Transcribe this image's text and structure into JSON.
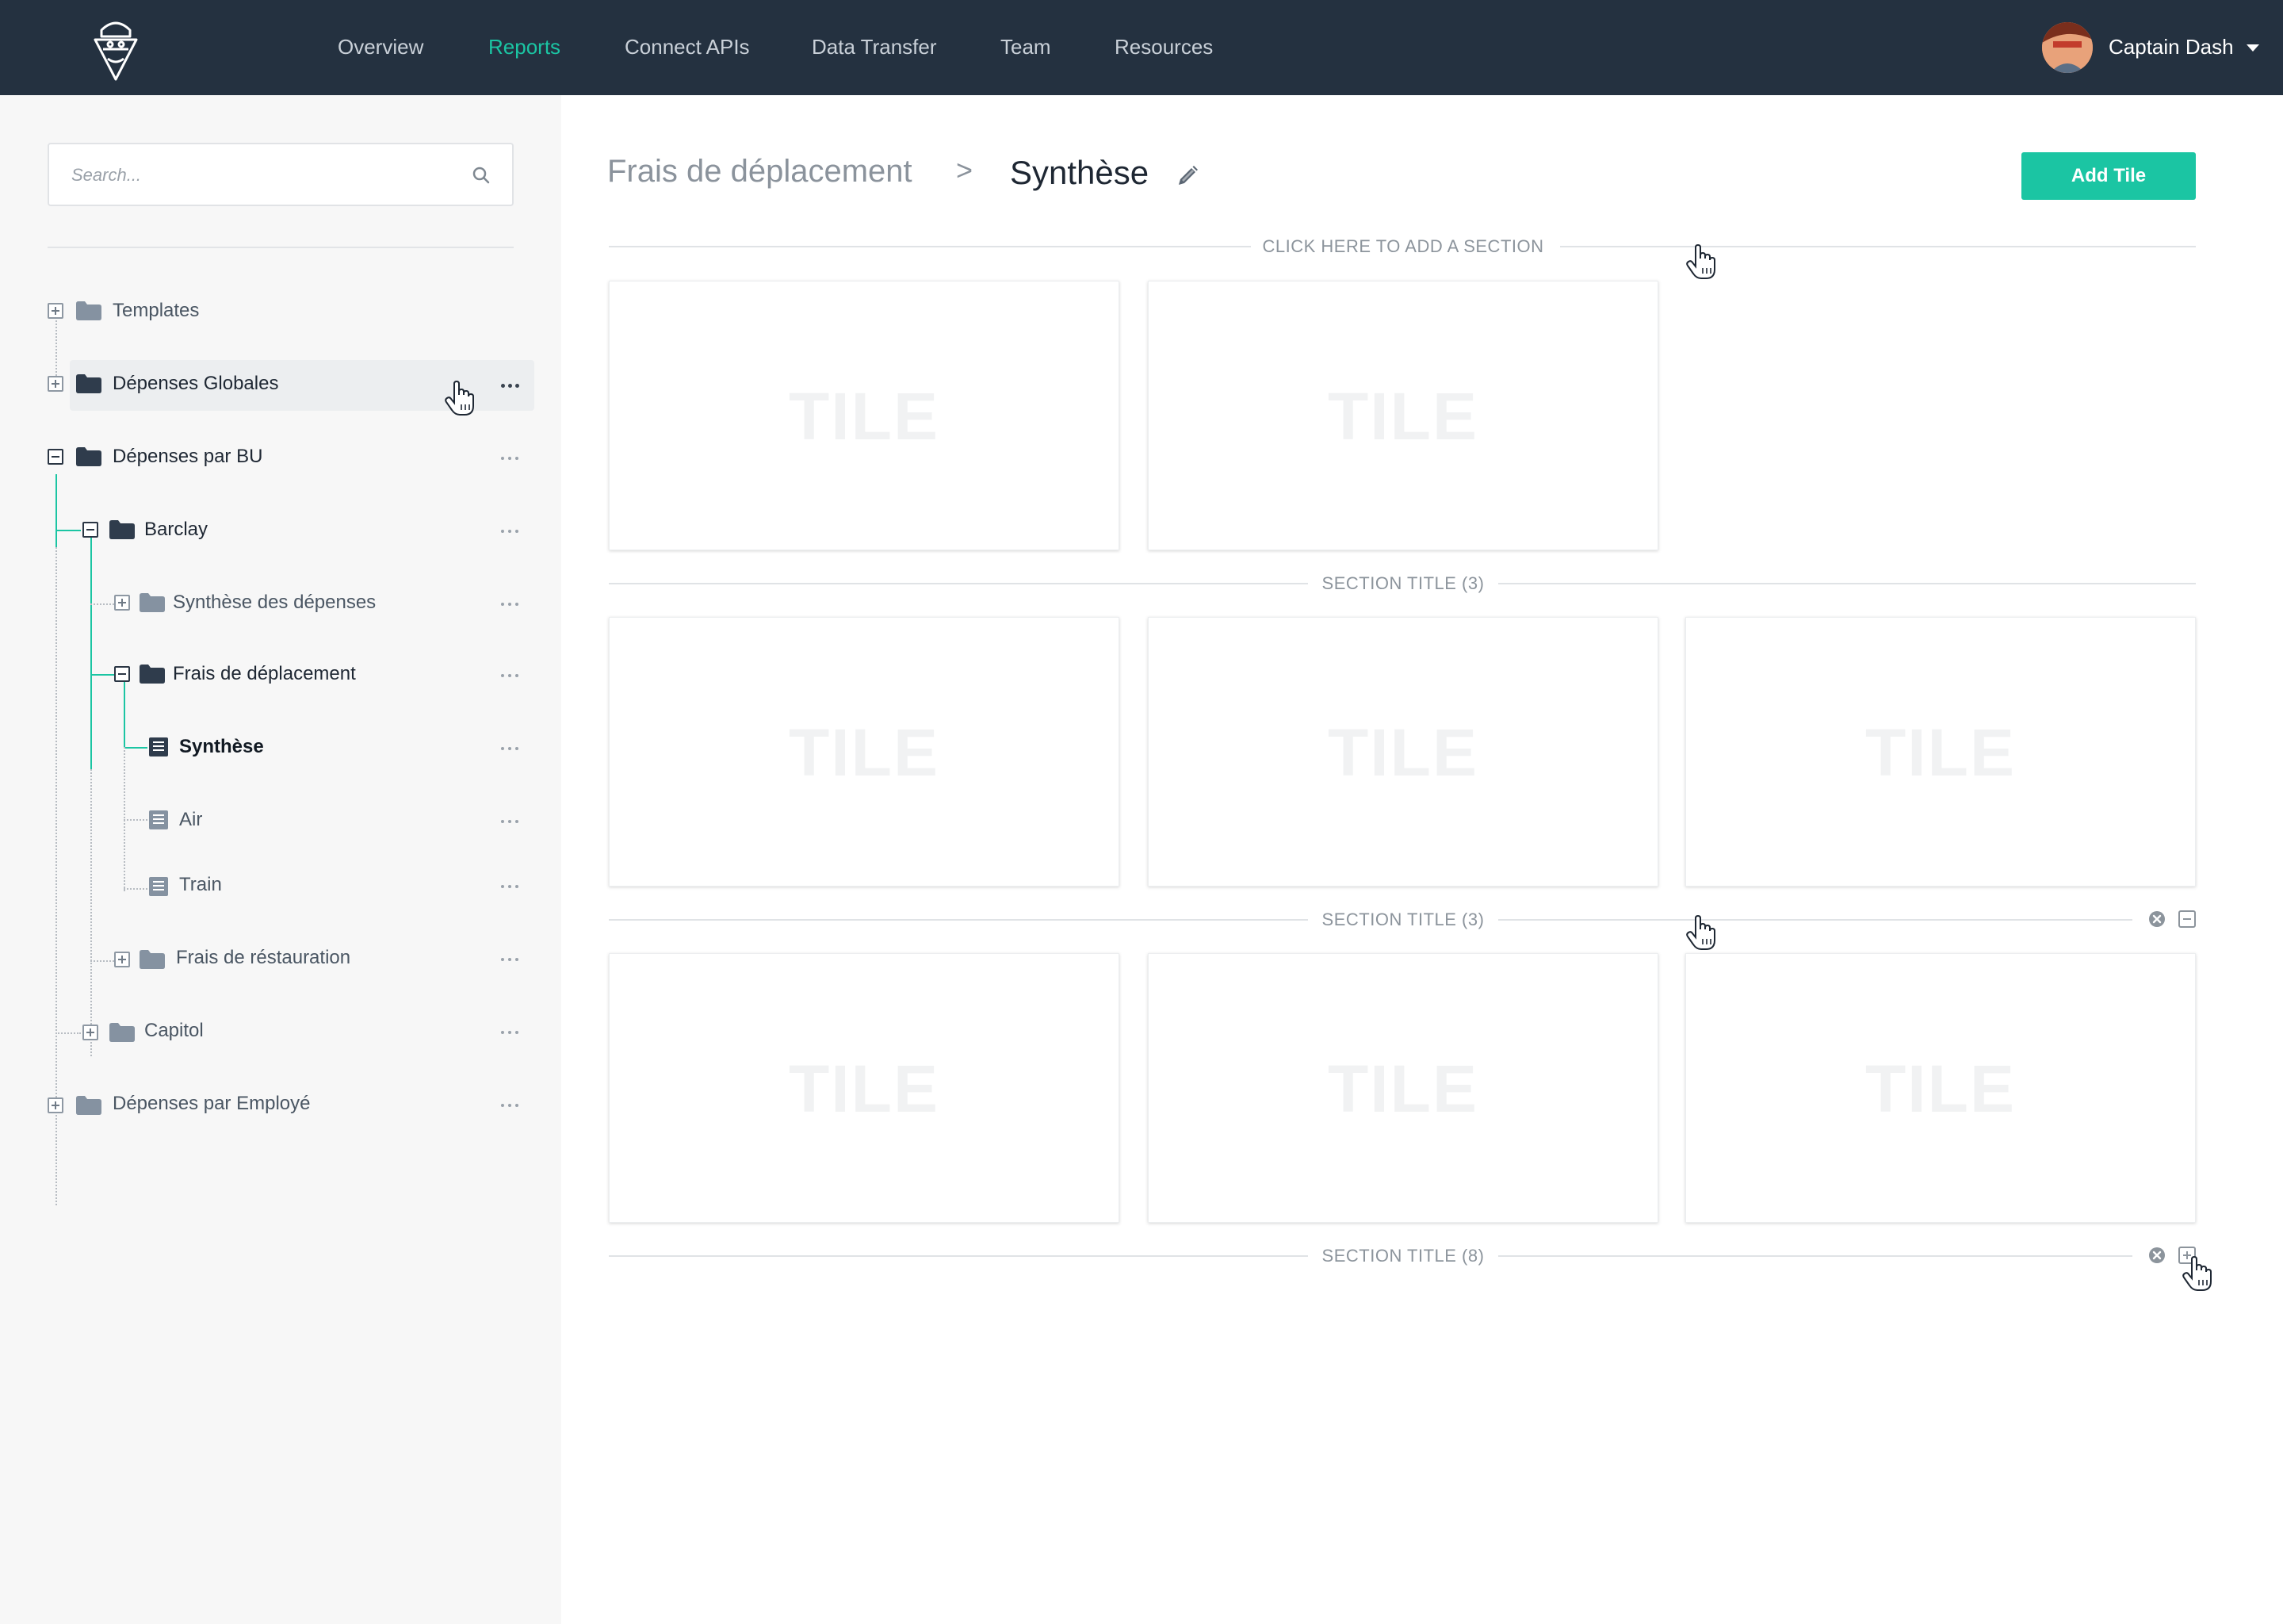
{
  "header": {
    "nav": [
      {
        "label": "Overview",
        "active": false
      },
      {
        "label": "Reports",
        "active": true
      },
      {
        "label": "Connect APIs",
        "active": false
      },
      {
        "label": "Data Transfer",
        "active": false
      },
      {
        "label": "Team",
        "active": false
      },
      {
        "label": "Resources",
        "active": false
      }
    ],
    "user_name": "Captain Dash"
  },
  "sidebar": {
    "search_placeholder": "Search...",
    "tree": [
      {
        "label": "Templates",
        "type": "folder",
        "state": "collapsed"
      },
      {
        "label": "Dépenses Globales",
        "type": "folder",
        "state": "collapsed",
        "hovered": true
      },
      {
        "label": "Dépenses par BU",
        "type": "folder",
        "state": "expanded"
      },
      {
        "label": "Barclay",
        "type": "folder",
        "state": "expanded"
      },
      {
        "label": "Synthèse des dépenses",
        "type": "folder",
        "state": "collapsed"
      },
      {
        "label": "Frais de déplacement",
        "type": "folder",
        "state": "expanded"
      },
      {
        "label": "Synthèse",
        "type": "report",
        "selected": true
      },
      {
        "label": "Air",
        "type": "report"
      },
      {
        "label": "Train",
        "type": "report"
      },
      {
        "label": "Frais de réstauration",
        "type": "folder",
        "state": "collapsed"
      },
      {
        "label": "Capitol",
        "type": "folder",
        "state": "collapsed"
      },
      {
        "label": "Dépenses par Employé",
        "type": "folder",
        "state": "collapsed"
      }
    ]
  },
  "main": {
    "breadcrumb_parent": "Frais de déplacement",
    "breadcrumb_separator": ">",
    "breadcrumb_current": "Synthèse",
    "add_tile_label": "Add Tile",
    "add_section_label": "CLICK HERE TO ADD A SECTION",
    "sections": [
      {
        "title": "",
        "tiles": [
          "TILE",
          "TILE"
        ]
      },
      {
        "title": "SECTION TITLE (3)",
        "tiles": [
          "TILE",
          "TILE",
          "TILE"
        ]
      },
      {
        "title": "SECTION TITLE (3)",
        "tiles": [
          "TILE",
          "TILE",
          "TILE"
        ],
        "controls": [
          "remove-icon",
          "collapse-icon"
        ]
      },
      {
        "title": "SECTION TITLE (8)",
        "tiles": [],
        "controls": [
          "remove-icon",
          "expand-icon"
        ]
      }
    ]
  },
  "colors": {
    "accent": "#1bc5a3",
    "topbar": "#243140",
    "sidebar_bg": "#f7f7f7"
  }
}
